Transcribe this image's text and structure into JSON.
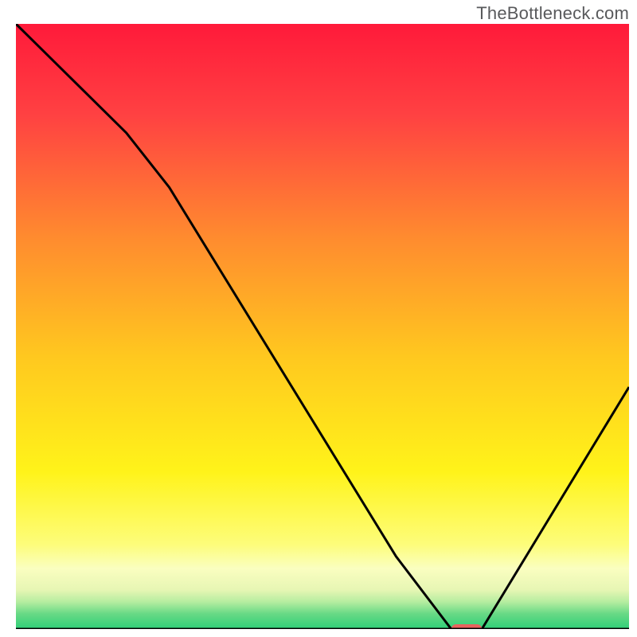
{
  "watermark": "TheBottleneck.com",
  "chart_data": {
    "type": "line",
    "title": "",
    "xlabel": "",
    "ylabel": "",
    "xlim": [
      0,
      100
    ],
    "ylim": [
      0,
      100
    ],
    "x_axis_visible": true,
    "y_axis_visible": false,
    "grid": false,
    "legend": false,
    "series": [
      {
        "name": "curve",
        "x": [
          0,
          18,
          25,
          62,
          71,
          76,
          100
        ],
        "values": [
          100,
          82,
          73,
          12,
          0,
          0,
          40
        ]
      }
    ],
    "marker": {
      "name": "optimum-marker",
      "x_center": 73.5,
      "y": 0,
      "x_extent": 5,
      "color": "#e8635e"
    },
    "background_gradient": {
      "stops": [
        {
          "offset": 0.0,
          "color": "#ff1a3a"
        },
        {
          "offset": 0.15,
          "color": "#ff4142"
        },
        {
          "offset": 0.35,
          "color": "#ff8a2f"
        },
        {
          "offset": 0.55,
          "color": "#ffc81f"
        },
        {
          "offset": 0.74,
          "color": "#fff31a"
        },
        {
          "offset": 0.86,
          "color": "#fdfd7a"
        },
        {
          "offset": 0.9,
          "color": "#fafec0"
        },
        {
          "offset": 0.935,
          "color": "#e7f6b4"
        },
        {
          "offset": 0.955,
          "color": "#b6eda0"
        },
        {
          "offset": 0.975,
          "color": "#67d985"
        },
        {
          "offset": 1.0,
          "color": "#2fcf78"
        }
      ]
    },
    "axis_stroke": "#000000",
    "axis_stroke_width": 3,
    "curve_stroke": "#000000",
    "curve_stroke_width": 3
  }
}
